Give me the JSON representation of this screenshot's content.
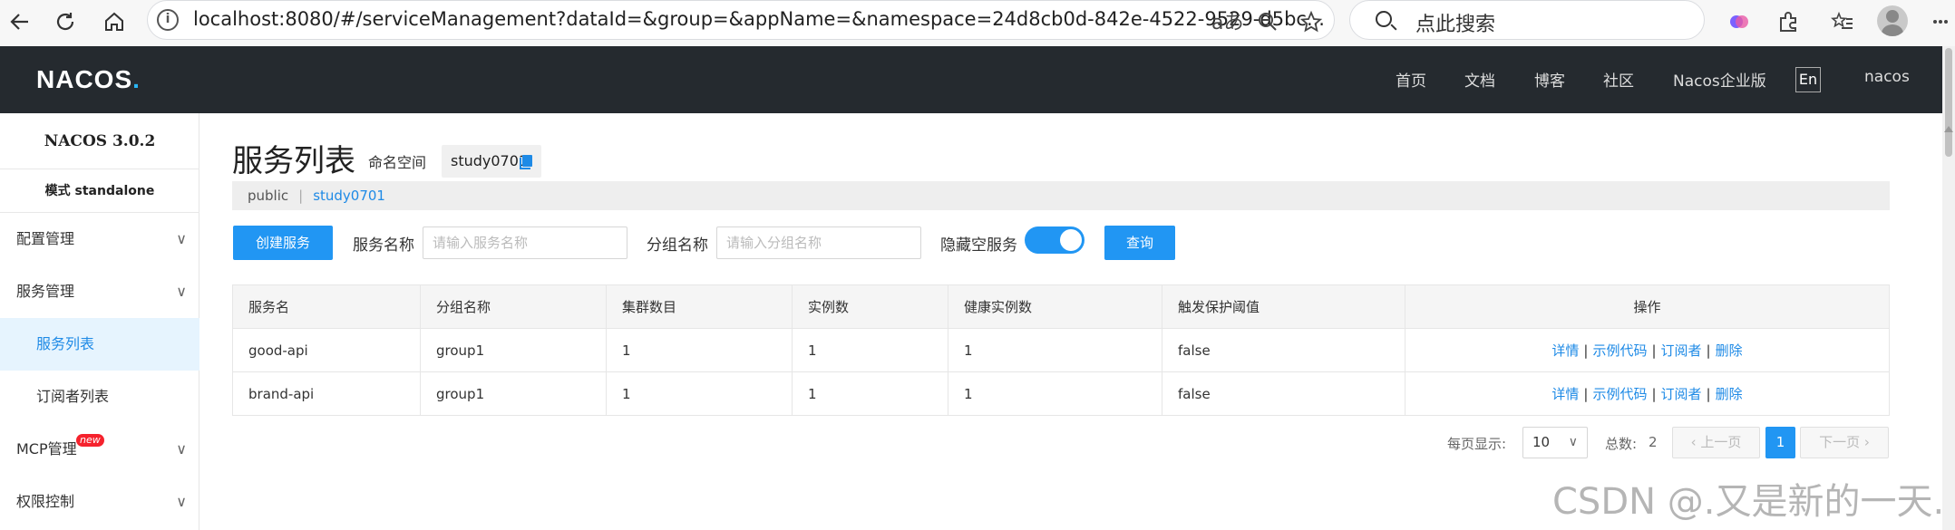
{
  "browser": {
    "url": "localhost:8080/#/serviceManagement?dataId=&group=&appName=&namespace=24d8cb0d-842e-4522-9529-d5bc...",
    "search_placeholder": "点此搜索",
    "info_icon_glyph": "i",
    "read_aloud_glyph": "aあ"
  },
  "header": {
    "logo_text": "NACOS",
    "logo_dot": ".",
    "nav": [
      "首页",
      "文档",
      "博客",
      "社区",
      "Nacos企业版"
    ],
    "lang_button": "En",
    "user": "nacos"
  },
  "sidebar": {
    "title": "NACOS 3.0.2",
    "mode": "模式 standalone",
    "items": [
      {
        "label": "配置管理",
        "expandable": true
      },
      {
        "label": "服务管理",
        "expandable": true
      },
      {
        "label": "服务列表",
        "sub": true,
        "active": true
      },
      {
        "label": "订阅者列表",
        "sub": true
      },
      {
        "label": "MCP管理",
        "expandable": true,
        "badge": "new"
      },
      {
        "label": "权限控制",
        "expandable": true
      }
    ]
  },
  "main": {
    "title": "服务列表",
    "namespace_label": "命名空间",
    "namespace_value": "study0701",
    "ns_bar": {
      "public": "public",
      "separator": "|",
      "current": "study0701"
    },
    "create_button": "创建服务",
    "service_name_label": "服务名称",
    "service_name_placeholder": "请输入服务名称",
    "group_name_label": "分组名称",
    "group_name_placeholder": "请输入分组名称",
    "hide_empty_label": "隐藏空服务",
    "hide_empty_on": true,
    "query_button": "查询"
  },
  "table": {
    "columns": [
      "服务名",
      "分组名称",
      "集群数目",
      "实例数",
      "健康实例数",
      "触发保护阈值",
      "操作"
    ],
    "rows": [
      {
        "name": "good-api",
        "group": "group1",
        "clusters": "1",
        "instances": "1",
        "healthy": "1",
        "threshold": "false"
      },
      {
        "name": "brand-api",
        "group": "group1",
        "clusters": "1",
        "instances": "1",
        "healthy": "1",
        "threshold": "false"
      }
    ],
    "actions": {
      "detail": "详情",
      "sample": "示例代码",
      "subscriber": "订阅者",
      "delete": "删除",
      "separator": "|"
    }
  },
  "pagination": {
    "per_page_label": "每页显示:",
    "per_page_value": "10",
    "total_label": "总数:",
    "total_value": "2",
    "prev": "上一页",
    "next": "下一页",
    "current_page": "1"
  },
  "watermark": "CSDN @.又是新的一天.",
  "colors": {
    "header_bg": "#252a2f",
    "primary": "#2196f3",
    "link": "#1e8ae6",
    "active_bg": "#e6f4fe"
  }
}
